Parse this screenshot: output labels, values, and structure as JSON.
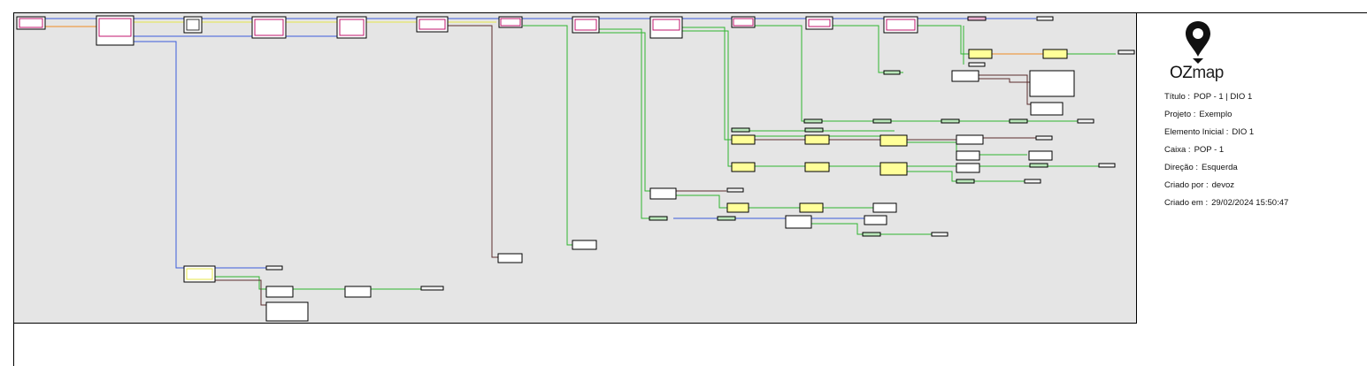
{
  "brand": {
    "logo_strong": "OZ",
    "logo_light": "map",
    "accent": "#111111"
  },
  "info": {
    "titulo": {
      "label": "Título :",
      "value": "POP - 1 | DIO 1"
    },
    "projeto": {
      "label": "Projeto :",
      "value": "Exemplo"
    },
    "elemento_inicial": {
      "label": "Elemento Inicial :",
      "value": "DIO 1"
    },
    "caixa": {
      "label": "Caixa :",
      "value": "POP - 1"
    },
    "direcao": {
      "label": "Direção :",
      "value": "Esquerda"
    },
    "criado_por": {
      "label": "Criado por :",
      "value": "devoz"
    },
    "criado_em": {
      "label": "Criado em :",
      "value": "29/02/2024 15:50:47"
    }
  },
  "diagram_colors": {
    "background": "#e5e5e5",
    "fiber_blue": "#3b5bdb",
    "fiber_green": "#2fb52f",
    "fiber_brown": "#5a2d2d",
    "fiber_orange": "#f08a24",
    "fiber_yellow": "#e6e64a",
    "fiber_magenta": "#c0146c"
  }
}
